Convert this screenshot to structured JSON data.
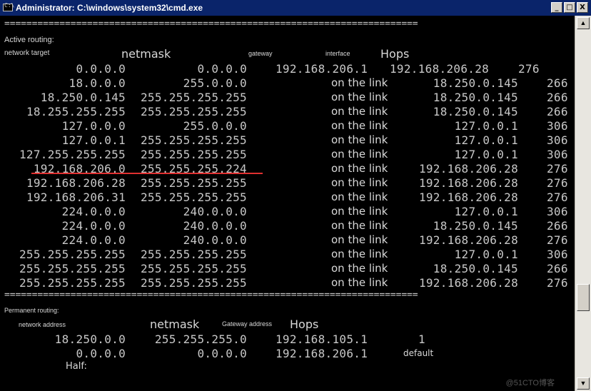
{
  "window": {
    "icon_text": "C:\\",
    "title": "Administrator: C:\\windows\\system32\\cmd.exe",
    "minimize": "_",
    "maximize": "□",
    "close": "X"
  },
  "separator": "===========================================================================",
  "active": {
    "heading": "Active routing:",
    "col_target": "network target",
    "col_netmask": "netmask",
    "col_gateway": "gateway",
    "col_interface": "interface",
    "col_hops": "Hops",
    "default_row": {
      "target": "0.0.0.0",
      "netmask": "0.0.0.0",
      "gateway": "192.168.206.1",
      "interface": "192.168.206.28",
      "metric": "276"
    },
    "rows": [
      {
        "target": "18.0.0.0",
        "netmask": "255.0.0.0",
        "gateway": "on the link",
        "interface": "18.250.0.145",
        "metric": "266"
      },
      {
        "target": "18.250.0.145",
        "netmask": "255.255.255.255",
        "gateway": "on the link",
        "interface": "18.250.0.145",
        "metric": "266"
      },
      {
        "target": "18.255.255.255",
        "netmask": "255.255.255.255",
        "gateway": "on the link",
        "interface": "18.250.0.145",
        "metric": "266"
      },
      {
        "target": "127.0.0.0",
        "netmask": "255.0.0.0",
        "gateway": "on the link",
        "interface": "127.0.0.1",
        "metric": "306"
      },
      {
        "target": "127.0.0.1",
        "netmask": "255.255.255.255",
        "gateway": "on the link",
        "interface": "127.0.0.1",
        "metric": "306"
      },
      {
        "target": "127.255.255.255",
        "netmask": "255.255.255.255",
        "gateway": "on the link",
        "interface": "127.0.0.1",
        "metric": "306"
      },
      {
        "target": "192.168.206.0",
        "netmask": "255.255.255.224",
        "gateway": "on the link",
        "interface": "192.168.206.28",
        "metric": "276"
      },
      {
        "target": "192.168.206.28",
        "netmask": "255.255.255.255",
        "gateway": "on the link",
        "interface": "192.168.206.28",
        "metric": "276"
      },
      {
        "target": "192.168.206.31",
        "netmask": "255.255.255.255",
        "gateway": "on the link",
        "interface": "192.168.206.28",
        "metric": "276"
      },
      {
        "target": "224.0.0.0",
        "netmask": "240.0.0.0",
        "gateway": "on the link",
        "interface": "127.0.0.1",
        "metric": "306"
      },
      {
        "target": "224.0.0.0",
        "netmask": "240.0.0.0",
        "gateway": "on the link",
        "interface": "18.250.0.145",
        "metric": "266"
      },
      {
        "target": "224.0.0.0",
        "netmask": "240.0.0.0",
        "gateway": "on the link",
        "interface": "192.168.206.28",
        "metric": "276"
      },
      {
        "target": "255.255.255.255",
        "netmask": "255.255.255.255",
        "gateway": "on the link",
        "interface": "127.0.0.1",
        "metric": "306"
      },
      {
        "target": "255.255.255.255",
        "netmask": "255.255.255.255",
        "gateway": "on the link",
        "interface": "18.250.0.145",
        "metric": "266"
      },
      {
        "target": "255.255.255.255",
        "netmask": "255.255.255.255",
        "gateway": "on the link",
        "interface": "192.168.206.28",
        "metric": "276"
      }
    ]
  },
  "permanent": {
    "heading": "Permanent routing:",
    "col_address": "network address",
    "col_netmask": "netmask",
    "col_gateway": "Gateway address",
    "col_hops": "Hops",
    "rows": [
      {
        "address": "18.250.0.0",
        "netmask": "255.255.255.0",
        "gateway": "192.168.105.1",
        "hops": "1"
      },
      {
        "address": "0.0.0.0",
        "netmask": "0.0.0.0",
        "gateway": "192.168.206.1",
        "hops": "default"
      }
    ],
    "footer": "Half:"
  },
  "watermark": "@51CTO博客",
  "colors": {
    "highlight_underline": "#e03030",
    "titlebar": "#0a246a"
  }
}
